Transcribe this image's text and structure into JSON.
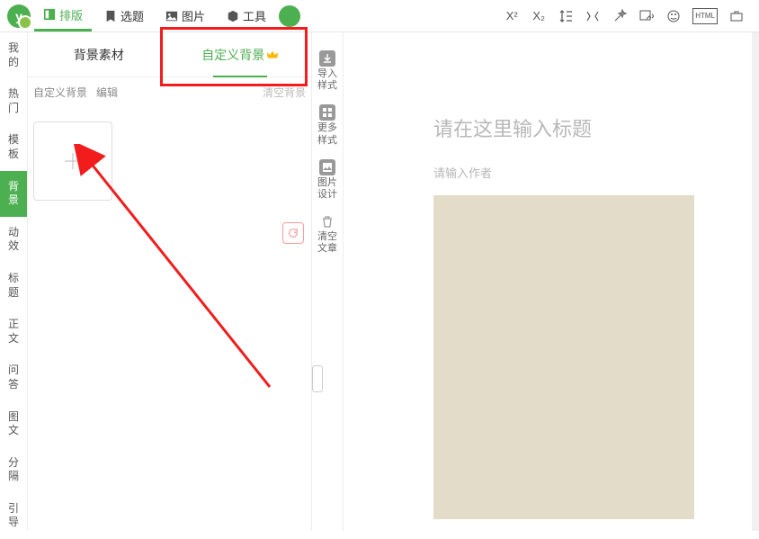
{
  "top_nav": {
    "layout": "排版",
    "topic": "选题",
    "image": "图片",
    "tools": "工具"
  },
  "top_tools": {
    "sup": "X²",
    "sub": "X₂"
  },
  "side_cats": [
    "我的",
    "热门",
    "模板",
    "背景",
    "动效",
    "标题",
    "正文",
    "问答",
    "图文",
    "分隔",
    "引导"
  ],
  "active_cat": "背景",
  "tabs": {
    "material": "背景素材",
    "custom": "自定义背景"
  },
  "subbar": {
    "custom": "自定义背景",
    "edit": "编辑",
    "clear": "清空背景"
  },
  "toolcol": {
    "import": "导入\n样式",
    "more": "更多\n样式",
    "imgdesign": "图片\n设计",
    "clear": "清空\n文章"
  },
  "editor": {
    "title_placeholder": "请在这里输入标题",
    "author_placeholder": "请输入作者"
  }
}
